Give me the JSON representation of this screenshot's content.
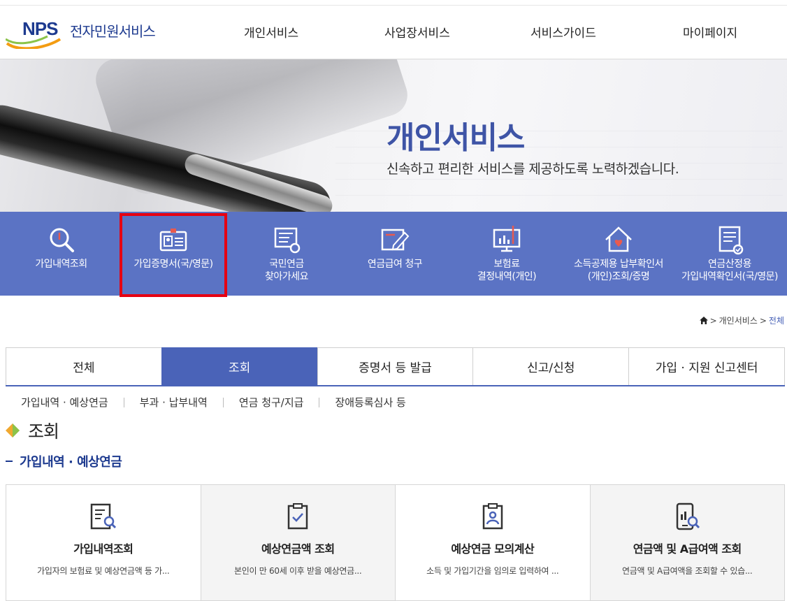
{
  "header": {
    "logo_text": "NPS",
    "logo_service": "전자민원서비스",
    "nav": [
      "개인서비스",
      "사업장서비스",
      "서비스가이드",
      "마이페이지"
    ]
  },
  "hero": {
    "title": "개인서비스",
    "subtitle": "신속하고 편리한 서비스를 제공하도록 노력하겠습니다."
  },
  "quick_menu": [
    {
      "label": "가입내역조회",
      "icon": "search-icon"
    },
    {
      "label": "가입증명서(국/영문)",
      "icon": "id-card-icon"
    },
    {
      "label": "국민연금\n찾아가세요",
      "icon": "document-check-icon"
    },
    {
      "label": "연금급여 청구",
      "icon": "edit-document-icon"
    },
    {
      "label": "보험료\n결정내역(개인)",
      "icon": "chart-monitor-icon"
    },
    {
      "label": "소득공제용 납부확인서\n(개인)조회/증명",
      "icon": "house-heart-icon"
    },
    {
      "label": "연금산정용\n가입내역확인서(국/영문)",
      "icon": "document-list-icon"
    }
  ],
  "breadcrumb": {
    "items": [
      "개인서비스",
      "전체"
    ]
  },
  "tabs": [
    {
      "label": "전체",
      "active": false
    },
    {
      "label": "조회",
      "active": true
    },
    {
      "label": "증명서 등 발급",
      "active": false
    },
    {
      "label": "신고/신청",
      "active": false
    },
    {
      "label": "가입 · 지원 신고센터",
      "active": false
    }
  ],
  "subnav": [
    "가입내역 · 예상연금",
    "부과 · 납부내역",
    "연금 청구/지급",
    "장애등록심사 등"
  ],
  "section_title": "조회",
  "subsection_title": "가입내역 · 예상연금",
  "cards": [
    {
      "title": "가입내역조회",
      "desc": "가입자의 보험료 및 예상연금액 등 가...",
      "icon": "document-search-icon"
    },
    {
      "title": "예상연금액 조회",
      "desc": "본인이 만 60세 이후 받을 예상연금...",
      "icon": "clipboard-check-icon"
    },
    {
      "title": "예상연금 모의계산",
      "desc": "소득 및 가입기간을 임의로 입력하여 ...",
      "icon": "clipboard-person-icon"
    },
    {
      "title": "연금액 및 A급여액 조회",
      "desc": "연금액 및 A급여액을 조회할 수 있습...",
      "icon": "mobile-chart-search-icon"
    }
  ],
  "colors": {
    "brand_blue": "#1d3a8f",
    "quick_bar": "#5b73c4",
    "tab_active": "#4a63b8",
    "highlight_red": "#e60012",
    "hero_title": "#3e54a6"
  }
}
